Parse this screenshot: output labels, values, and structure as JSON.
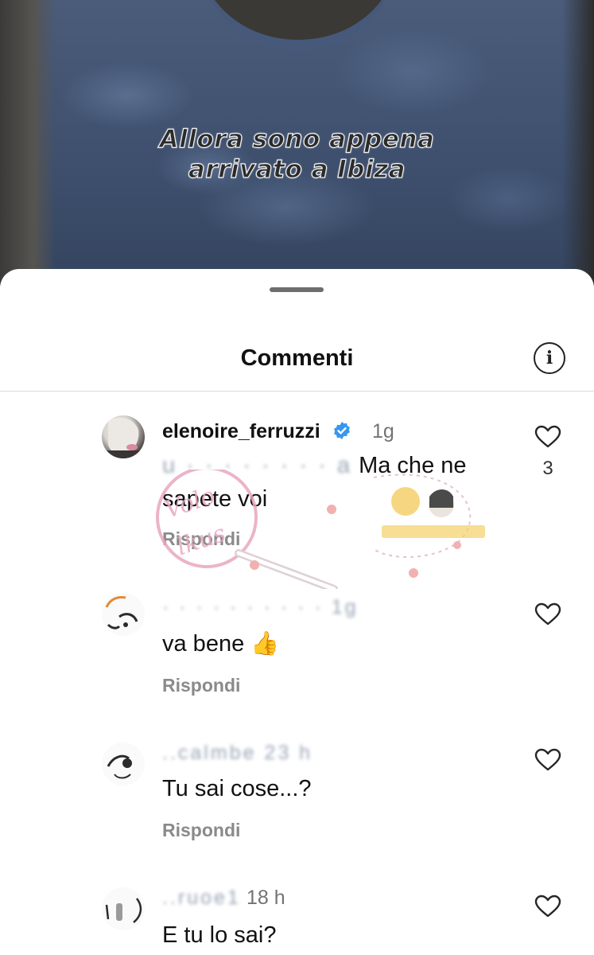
{
  "video": {
    "caption_line1": "Allora sono appena",
    "caption_line2": "arrivato a Ibiza"
  },
  "sheet": {
    "title": "Commenti",
    "info_icon": "info-icon"
  },
  "comments": [
    {
      "username": "elenoire_ferruzzi",
      "verified": true,
      "time": "1g",
      "mention_blurred": "u · · · · · · · · a",
      "text_line1": "Ma che ne",
      "text_line2": "sapete voi",
      "reply_label": "Rispondi",
      "likes": "3"
    },
    {
      "username": "",
      "username_blurred": "· · · · · · · · · · 1g",
      "text": "va bene 👍",
      "reply_label": "Rispondi"
    },
    {
      "username_blurred": "..calmbe  23 h",
      "text": "Tu sai cose...?",
      "reply_label": "Rispondi"
    },
    {
      "username_blurred": "..ruoe1",
      "time": "18 h",
      "text": "E tu lo sai?"
    }
  ],
  "colors": {
    "verified_blue": "#3797f0",
    "reply_gray": "#8a8a8a",
    "watermark_pink": "#e8a7c0"
  }
}
